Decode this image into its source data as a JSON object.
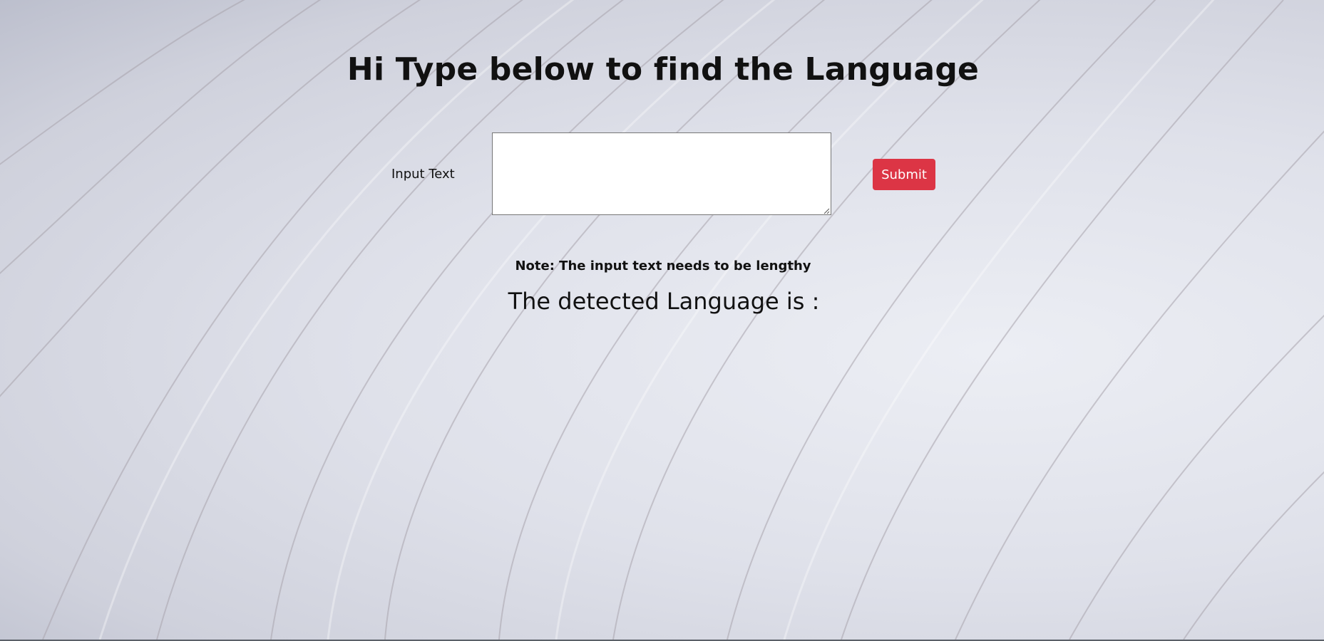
{
  "page": {
    "heading": "Hi Type below to find the Language",
    "background_colors": {
      "light": "#e6e8f0",
      "mid": "#d3d5e0",
      "dark": "#bcbfcd",
      "wave_stroke": "#a9a4ad"
    }
  },
  "form": {
    "input_label": "Input Text",
    "input_value": "",
    "input_placeholder": "",
    "submit_label": "Submit",
    "submit_color": "#dc3545"
  },
  "note": "Note: The input text needs to be lengthy",
  "result": {
    "label": "The detected Language is :",
    "value": ""
  }
}
